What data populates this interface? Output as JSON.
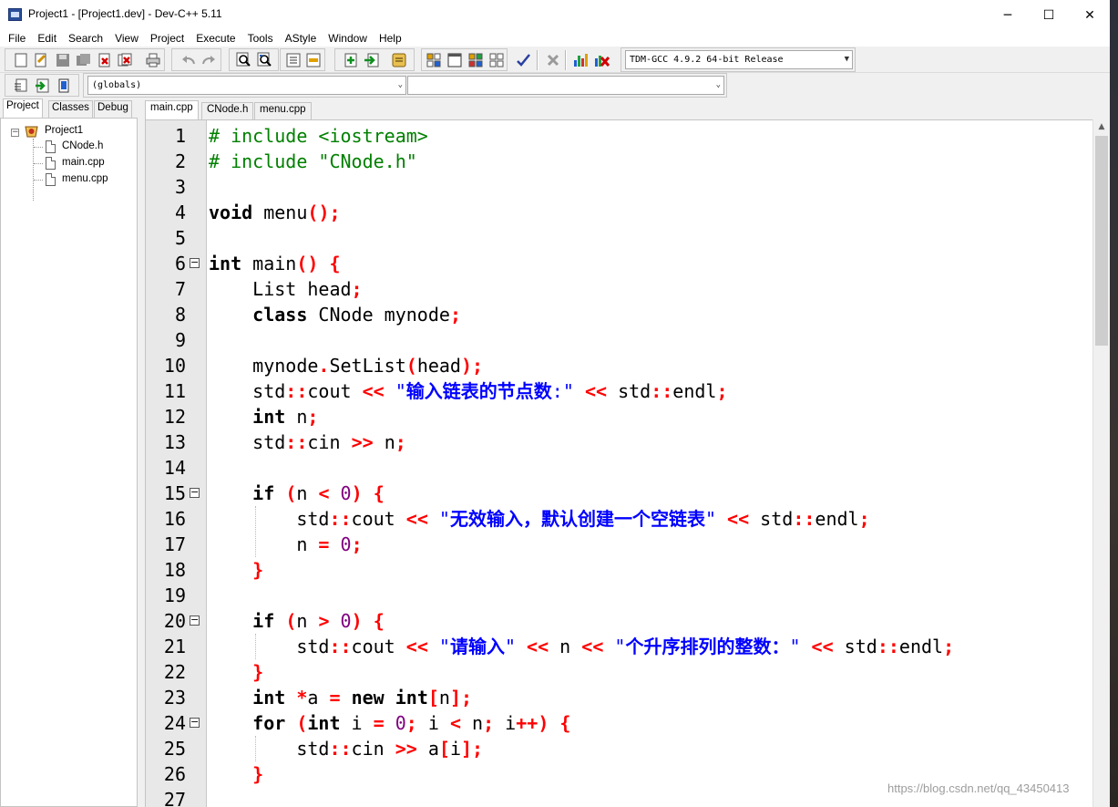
{
  "window": {
    "title": "Project1 - [Project1.dev] - Dev-C++ 5.11",
    "controls": {
      "minimize": "─",
      "maximize": "☐",
      "close": "✕"
    }
  },
  "menubar": {
    "items": [
      "File",
      "Edit",
      "Search",
      "View",
      "Project",
      "Execute",
      "Tools",
      "AStyle",
      "Window",
      "Help"
    ]
  },
  "toolbar": {
    "compiler_select": "TDM-GCC 4.9.2 64-bit Release",
    "scope_select": "(globals)",
    "function_select": ""
  },
  "left_panel": {
    "tabs": [
      "Project",
      "Classes",
      "Debug"
    ],
    "active_tab": "Project",
    "tree": {
      "project_name": "Project1",
      "files": [
        "CNode.h",
        "main.cpp",
        "menu.cpp"
      ]
    }
  },
  "editor": {
    "tabs": [
      "main.cpp",
      "CNode.h",
      "menu.cpp"
    ],
    "active_tab": "main.cpp",
    "line_numbers": [
      "1",
      "2",
      "3",
      "4",
      "5",
      "6",
      "7",
      "8",
      "9",
      "10",
      "11",
      "12",
      "13",
      "14",
      "15",
      "16",
      "17",
      "18",
      "19",
      "20",
      "21",
      "22",
      "23",
      "24",
      "25",
      "26",
      "27"
    ],
    "lines": [
      "# include <iostream>",
      "# include \"CNode.h\"",
      "",
      "void menu();",
      "",
      "int main() {",
      "    List head;",
      "    class CNode mynode;",
      "",
      "    mynode.SetList(head);",
      "    std::cout << \"输入链表的节点数:\" << std::endl;",
      "    int n;",
      "    std::cin >> n;",
      "",
      "    if (n < 0) {",
      "        std::cout << \"无效输入，默认创建一个空链表\" << std::endl;",
      "        n = 0;",
      "    }",
      "",
      "    if (n > 0) {",
      "        std::cout << \"请输入\" << n << \"个升序排列的整数：\" << std::endl;",
      "    }",
      "    int *a = new int[n];",
      "    for (int i = 0; i < n; i++) {",
      "        std::cin >> a[i];",
      "    }",
      ""
    ],
    "fold_lines": [
      "6",
      "15",
      "20",
      "24"
    ]
  },
  "watermark": "https://blog.csdn.net/qq_43450413",
  "colors": {
    "keyword": "#000000",
    "preprocessor": "#008000",
    "string": "#0000ff",
    "symbol": "#ff0000",
    "number": "#800080",
    "gutter": "#e8e8e8"
  }
}
